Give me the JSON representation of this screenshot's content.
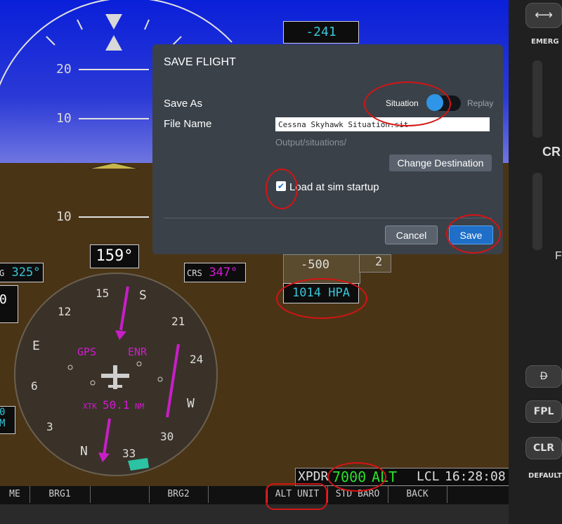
{
  "pfd": {
    "pitch_labels": [
      "20",
      "10",
      "10"
    ],
    "vsi_target": "-241",
    "vsi_scale": "-500",
    "vsi_scale_small": "2",
    "heading": "159°",
    "hdg_bug_label": "G",
    "hdg_bug_value": "325°",
    "crs_label": "CRS",
    "crs_value": "347°",
    "left_box_value": "0",
    "baro": "1014 HPA",
    "compass": {
      "card_labels": [
        "15",
        "S",
        "21",
        "24",
        "W",
        "30",
        "N",
        "33",
        "6",
        "E",
        "12",
        "3"
      ],
      "gps_label": "GPS",
      "enr_label": "ENR",
      "xtk_label": "XTK",
      "xtk_value": "50.1",
      "xtk_unit": "NM"
    },
    "left_fragments": [
      "0",
      "M"
    ],
    "status": {
      "xpdr_label": "XPDR",
      "squawk": "7000",
      "mode": "ALT",
      "lcl_label": "LCL",
      "time": "16:28:08"
    },
    "softkeys": [
      "ME",
      "BRG1",
      "",
      "BRG2",
      "",
      "ALT UNIT",
      "STD BARO",
      "BACK",
      ""
    ]
  },
  "bezel": {
    "emerg": "EMERG",
    "cr": "CR",
    "default": "DEFAULT",
    "fpl": "FPL",
    "clr": "CLR",
    "d_btn": "D",
    "partial": "F"
  },
  "dialog": {
    "title": "SAVE FLIGHT",
    "save_as_label": "Save As",
    "option_situation": "Situation",
    "option_replay": "Replay",
    "file_name_label": "File Name",
    "file_name_value": "Cessna Skyhawk Situation.sit",
    "output_path": "Output/situations/",
    "change_destination": "Change Destination",
    "load_at_startup": "Load at sim startup",
    "load_at_startup_checked": true,
    "cancel": "Cancel",
    "save": "Save"
  },
  "colors": {
    "accent": "#1f6fc8",
    "toggle": "#2f95e6",
    "annotation": "#d41414",
    "magenta": "#d21ad2",
    "cyan": "#39c6d8",
    "green": "#27e227"
  }
}
